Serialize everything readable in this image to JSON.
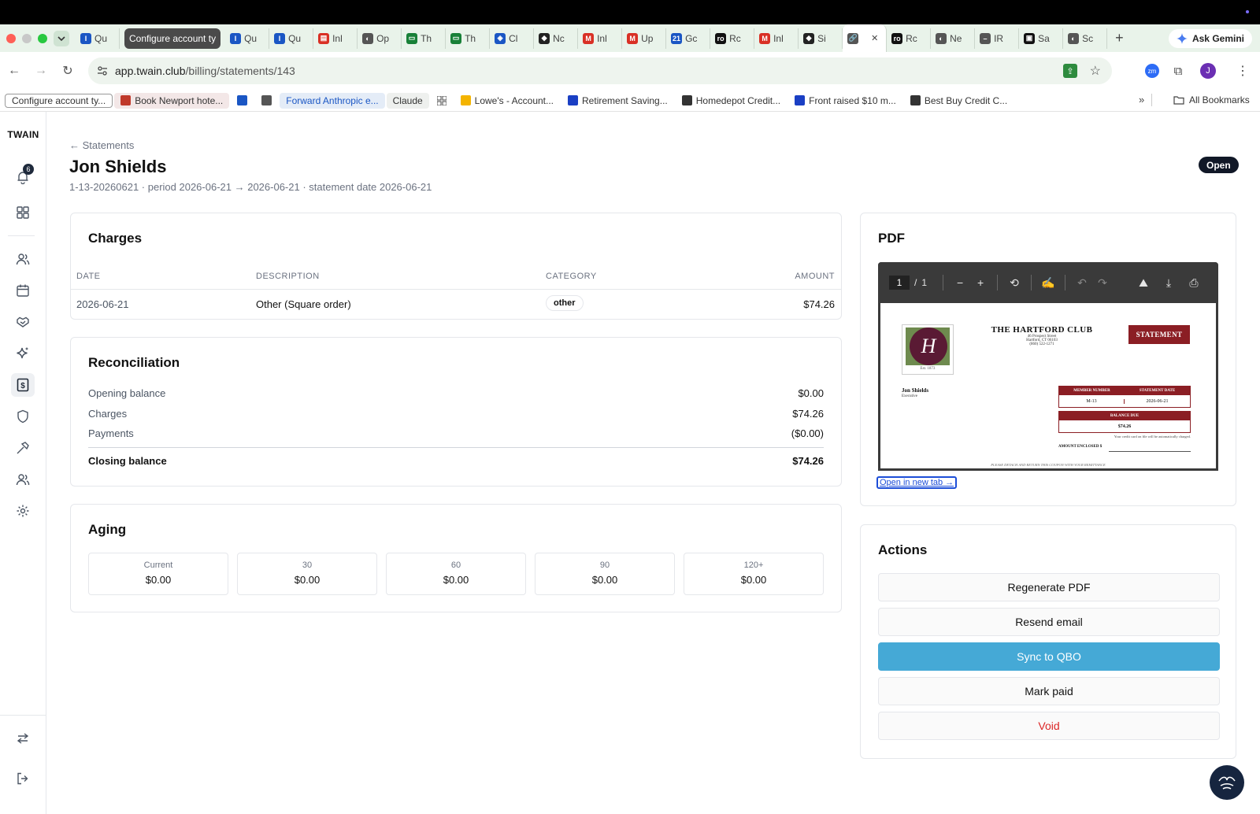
{
  "browser": {
    "tabs": [
      {
        "label": "Qu",
        "fav_color": "#1a56c4",
        "fav_text": "I"
      },
      {
        "label": "Configure account ty",
        "group": true
      },
      {
        "label": "Qu",
        "fav_color": "#1a56c4",
        "fav_text": "I"
      },
      {
        "label": "Qu",
        "fav_color": "#1a56c4",
        "fav_text": "I"
      },
      {
        "label": "Inl",
        "fav_color": "#d93025",
        "fav_text": "▤"
      },
      {
        "label": "Op",
        "fav_color": "#555555",
        "fav_text": "◐"
      },
      {
        "label": "Th",
        "fav_color": "#188038",
        "fav_text": "▭"
      },
      {
        "label": "Th",
        "fav_color": "#188038",
        "fav_text": "▭"
      },
      {
        "label": "Cl",
        "fav_color": "#1a56c4",
        "fav_text": "◈"
      },
      {
        "label": "Nc",
        "fav_color": "#222222",
        "fav_text": "◆"
      },
      {
        "label": "Inl",
        "fav_color": "#d93025",
        "fav_text": "M"
      },
      {
        "label": "Up",
        "fav_color": "#d93025",
        "fav_text": "M"
      },
      {
        "label": "Gc",
        "fav_color": "#1a56c4",
        "fav_text": "21"
      },
      {
        "label": "Rc",
        "fav_color": "#111111",
        "fav_text": "ro"
      },
      {
        "label": "Inl",
        "fav_color": "#d93025",
        "fav_text": "M"
      },
      {
        "label": "Si",
        "fav_color": "#222222",
        "fav_text": "◆"
      },
      {
        "label": "",
        "fav_color": "#555555",
        "fav_text": "🔗",
        "active": true
      },
      {
        "label": "Rc",
        "fav_color": "#111111",
        "fav_text": "ro"
      },
      {
        "label": "Ne",
        "fav_color": "#555555",
        "fav_text": "◐"
      },
      {
        "label": "IR",
        "fav_color": "#555555",
        "fav_text": "–"
      },
      {
        "label": "Sa",
        "fav_color": "#111111",
        "fav_text": "▣"
      },
      {
        "label": "Sc",
        "fav_color": "#555555",
        "fav_text": "◐"
      }
    ],
    "gemini_label": "Ask Gemini",
    "url_host": "app.twain.club",
    "url_path": "/billing/statements/143",
    "avatar_letter": "J",
    "bookmarks": [
      {
        "label": "Configure account ty...",
        "style": "boxed"
      },
      {
        "label": "Book Newport hote...",
        "style": "pill",
        "fav_color": "#c0392b"
      },
      {
        "label": "",
        "style": "plain",
        "fav_color": "#1a56c4"
      },
      {
        "label": "",
        "style": "plain",
        "fav_color": "#555555"
      },
      {
        "label": "Forward Anthropic e...",
        "style": "pillb"
      },
      {
        "label": "Claude",
        "style": "pillg"
      },
      {
        "label": "",
        "style": "grid"
      },
      {
        "label": "Lowe's - Account...",
        "style": "plain",
        "fav_color": "#f4b400"
      },
      {
        "label": "Retirement Saving...",
        "style": "plain",
        "fav_color": "#1a3fc4"
      },
      {
        "label": "Homedepot Credit...",
        "style": "plain",
        "fav_color": "#333333"
      },
      {
        "label": "Front raised $10 m...",
        "style": "plain",
        "fav_color": "#1a3fc4"
      },
      {
        "label": "Best Buy Credit C...",
        "style": "plain",
        "fav_color": "#333333"
      }
    ],
    "all_bookmarks": "All Bookmarks"
  },
  "sidebar": {
    "logo": "TWAIN",
    "notification_count": "6",
    "items": [
      "bell-icon",
      "dashboard-icon",
      "members-icon",
      "calendar-icon",
      "handshake-icon",
      "sparkle-icon",
      "billing-icon",
      "shield-icon",
      "hammer-icon",
      "staff-icon",
      "gear-icon"
    ],
    "bottom": [
      "switch-icon",
      "logout-icon"
    ]
  },
  "page": {
    "back_label": "← Statements",
    "title": "Jon Shields",
    "subtitle": "1-13-20260621 · period 2026-06-21 → 2026-06-21 · statement date 2026-06-21",
    "status": "Open"
  },
  "charges": {
    "title": "Charges",
    "headers": {
      "date": "DATE",
      "description": "DESCRIPTION",
      "category": "CATEGORY",
      "amount": "AMOUNT"
    },
    "rows": [
      {
        "date": "2026-06-21",
        "description": "Other (Square order)",
        "category": "other",
        "amount": "$74.26"
      }
    ]
  },
  "reconciliation": {
    "title": "Reconciliation",
    "rows": [
      {
        "label": "Opening balance",
        "value": "$0.00"
      },
      {
        "label": "Charges",
        "value": "$74.26"
      },
      {
        "label": "Payments",
        "value": "($0.00)"
      }
    ],
    "closing": {
      "label": "Closing balance",
      "value": "$74.26"
    }
  },
  "aging": {
    "title": "Aging",
    "buckets": [
      {
        "label": "Current",
        "value": "$0.00"
      },
      {
        "label": "30",
        "value": "$0.00"
      },
      {
        "label": "60",
        "value": "$0.00"
      },
      {
        "label": "90",
        "value": "$0.00"
      },
      {
        "label": "120+",
        "value": "$0.00"
      }
    ]
  },
  "pdf": {
    "title": "PDF",
    "page_current": "1",
    "page_sep": "/",
    "page_total": "1",
    "open_link": "Open in new tab →",
    "doc": {
      "club_name": "THE HARTFORD CLUB",
      "address1": "46 Prospect Street",
      "address2": "Hartford, CT 06103",
      "phone": "(860) 522-1271",
      "logo_letter": "H",
      "est": "Est. 1873",
      "statement_label": "STATEMENT",
      "member_name": "Jon Shields",
      "member_type": "Executive",
      "member_number_label": "MEMBER NUMBER",
      "member_number": "M-13",
      "statement_date_label": "STATEMENT DATE",
      "statement_date": "2026-06-21",
      "balance_due_label": "BALANCE DUE",
      "balance_due": "$74.26",
      "card_note": "Your credit card on file will be automatically charged.",
      "amount_enclosed": "AMOUNT ENCLOSED $",
      "detach_note": "PLEASE DETACH AND RETURN THIS COUPON WITH YOUR REMITTANCE"
    }
  },
  "actions": {
    "title": "Actions",
    "regenerate": "Regenerate PDF",
    "resend": "Resend email",
    "sync": "Sync to QBO",
    "mark_paid": "Mark paid",
    "void": "Void"
  },
  "colors": {
    "primary": "#45a9d6",
    "danger": "#dc2626",
    "dark": "#111827",
    "statement_red": "#8b1e24"
  }
}
